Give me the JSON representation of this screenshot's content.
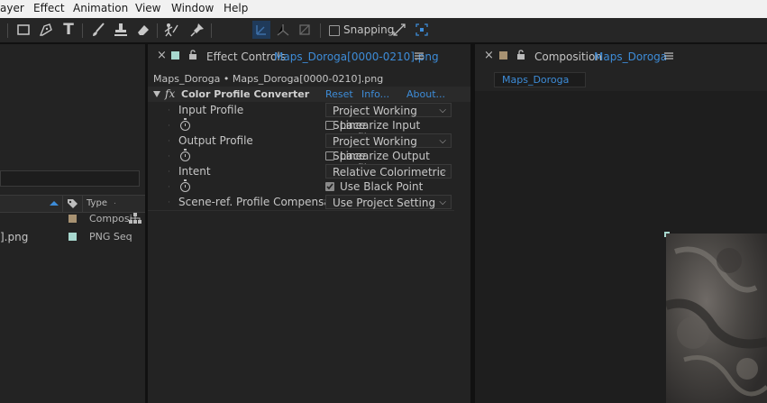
{
  "menu": {
    "items": [
      "ayer",
      "Effect",
      "Animation",
      "View",
      "Window",
      "Help"
    ]
  },
  "toolbar": {
    "snapping_label": "Snapping"
  },
  "project": {
    "col_type": "Type",
    "rows": [
      {
        "name": "",
        "type": "Composi",
        "swatch": "#a89272"
      },
      {
        "name": "].png",
        "type": "PNG Seq",
        "swatch": "#a8d8cf"
      }
    ]
  },
  "effect_panel": {
    "tab_prefix": "Effect Controls",
    "tab_file": "Maps_Doroga[0000-0210].png",
    "breadcrumb": "Maps_Doroga • Maps_Doroga[0000-0210].png",
    "fx_label": "fx",
    "effect_name": "Color Profile Converter",
    "reset": "Reset",
    "info": "Info...",
    "about": "About...",
    "input_profile_label": "Input Profile",
    "input_profile_value": "Project Working Space",
    "linearize_input": "Linearize Input Profile",
    "output_profile_label": "Output Profile",
    "output_profile_value": "Project Working Space",
    "linearize_output": "Linearize Output Profile",
    "intent_label": "Intent",
    "intent_value": "Relative Colorimetric",
    "black_point": "Use Black Point Compens",
    "scene_label": "Scene-ref. Profile Compensation",
    "scene_value": "Use Project Setting"
  },
  "comp_panel": {
    "tab_prefix": "Composition",
    "tab_name": "Maps_Doroga",
    "subtab": "Maps_Doroga"
  },
  "colors": {
    "accent": "#3d8cd8",
    "comp_swatch": "#a89272",
    "png_swatch": "#a8d8cf"
  }
}
